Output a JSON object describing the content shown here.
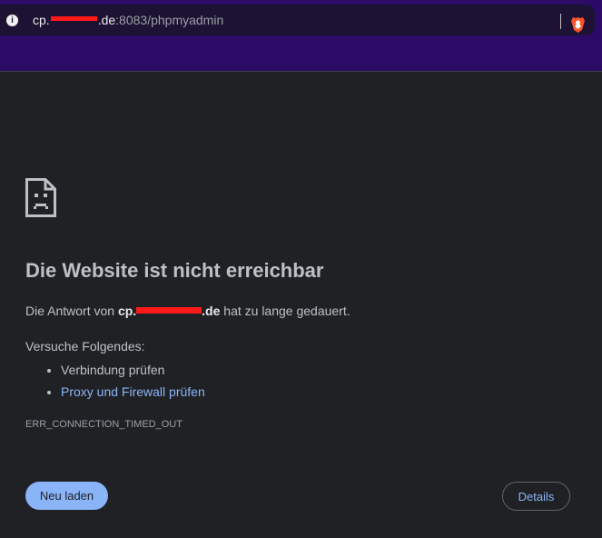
{
  "browser": {
    "url_prefix": "cp.",
    "url_domain_suffix": ".de",
    "url_path": ":8083/phpmyadmin",
    "info_icon": "info-icon",
    "shield_icon": "brave-shields-icon"
  },
  "error": {
    "icon": "sad-document-icon",
    "title": "Die Website ist nicht erreichbar",
    "desc_prefix": "Die Antwort von ",
    "desc_host_prefix": "cp.",
    "desc_host_suffix": ".de",
    "desc_suffix": " hat zu lange gedauert.",
    "suggestions_heading": "Versuche Folgendes:",
    "suggestions": [
      "Verbindung prüfen",
      "Proxy und Firewall prüfen"
    ],
    "error_code": "ERR_CONNECTION_TIMED_OUT",
    "reload_label": "Neu laden",
    "details_label": "Details"
  },
  "colors": {
    "toolbar": "#2b0b66",
    "omnibox": "#1d1233",
    "page_background": "#202124",
    "link": "#8ab4f8",
    "redaction": "#ff1a1a"
  }
}
